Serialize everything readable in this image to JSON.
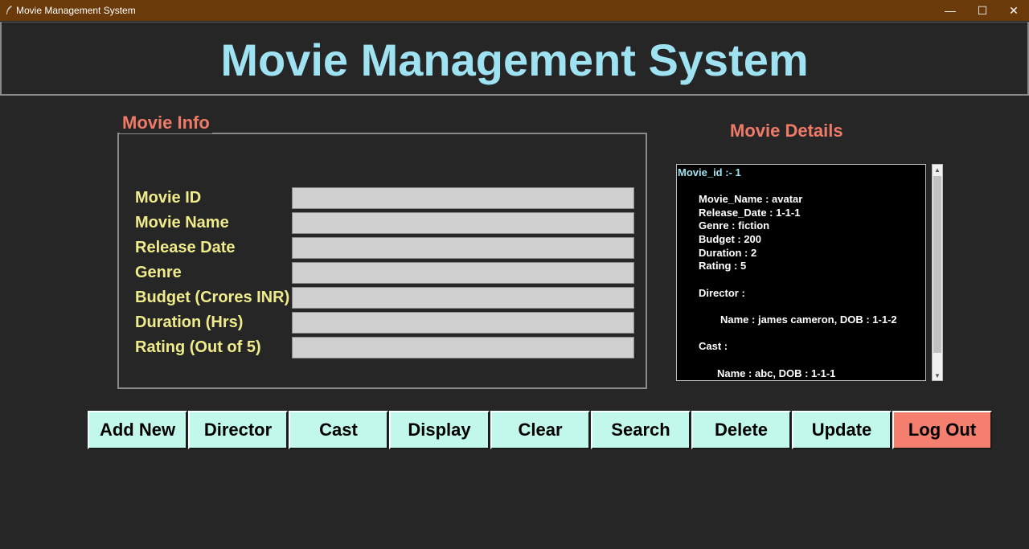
{
  "window": {
    "title": "Movie Management System",
    "minimize": "—",
    "maximize": "☐",
    "close": "✕"
  },
  "header": {
    "title": "Movie Management System"
  },
  "form": {
    "legend": "Movie Info",
    "fields": [
      {
        "label": "Movie ID",
        "value": ""
      },
      {
        "label": "Movie Name",
        "value": ""
      },
      {
        "label": "Release Date",
        "value": ""
      },
      {
        "label": "Genre",
        "value": ""
      },
      {
        "label": "Budget (Crores INR)",
        "value": ""
      },
      {
        "label": "Duration (Hrs)",
        "value": ""
      },
      {
        "label": "Rating (Out of 5)",
        "value": ""
      }
    ]
  },
  "details": {
    "title": "Movie Details",
    "lines": [
      "Movie_id :- 1",
      "Movie_Name : avatar",
      "Release_Date : 1-1-1",
      "Genre : fiction",
      "Budget : 200",
      "Duration : 2",
      "Rating : 5",
      "Director :",
      "Name : james cameron, DOB : 1-1-2",
      "Cast :",
      "Name : abc, DOB : 1-1-1"
    ]
  },
  "buttons": [
    "Add New",
    "Director",
    "Cast",
    "Display",
    "Clear",
    "Search",
    "Delete",
    "Update",
    "Log Out"
  ],
  "colors": {
    "background": "#262626",
    "title_bar": "#6b3a0a",
    "header_text": "#9fe3f2",
    "section_title": "#f07a68",
    "label_text": "#f0ec8c",
    "button": "#c2f7ec",
    "logout_button": "#f47f6e"
  }
}
